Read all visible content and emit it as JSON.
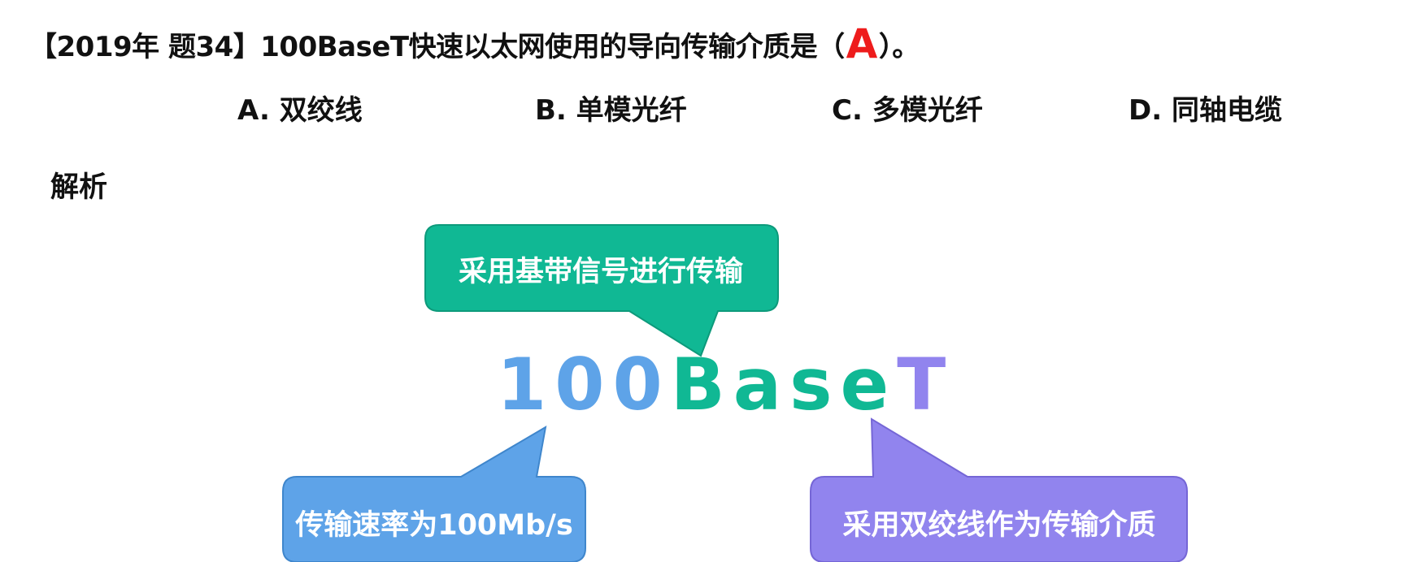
{
  "question": {
    "prefix": "【2019年 题34】100BaseT快速以太网使用的导向传输介质是（",
    "answer": "A",
    "suffix": "）。"
  },
  "options": [
    {
      "label": "A. 双绞线"
    },
    {
      "label": "B. 单模光纤"
    },
    {
      "label": "C. 多模光纤"
    },
    {
      "label": "D. 同轴电缆"
    }
  ],
  "analysis": {
    "title": "解析",
    "term": {
      "part1": "100",
      "part2": "Base",
      "part3": "T"
    },
    "bubbles": {
      "top": "采用基带信号进行传输",
      "left": "传输速率为100Mb/s",
      "right": "采用双绞线作为传输介质"
    }
  },
  "colors": {
    "answer": "#ee1c1c",
    "speed": "#5ea3e8",
    "baseband": "#10b894",
    "twisted_pair": "#9184ee"
  }
}
